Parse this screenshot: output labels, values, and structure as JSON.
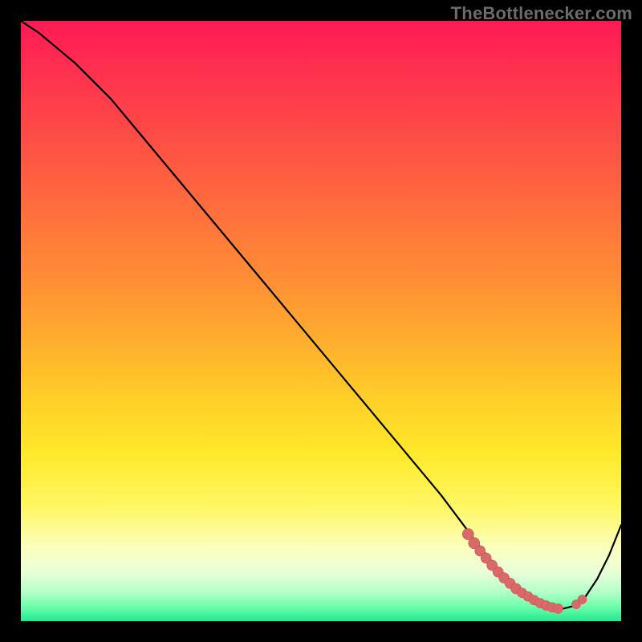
{
  "attribution": "TheBottlenecker.com",
  "colors": {
    "page_bg": "#000000",
    "curve": "#000000",
    "dot_fill": "#d86a6a",
    "dot_stroke": "#c85151",
    "attribution_text": "#6b6b6b"
  },
  "chart_data": {
    "type": "line",
    "title": "",
    "xlabel": "",
    "ylabel": "",
    "xlim": [
      0,
      100
    ],
    "ylim": [
      0,
      100
    ],
    "series": [
      {
        "name": "bottleneck_curve",
        "x": [
          0,
          3,
          6,
          9,
          12,
          15,
          20,
          25,
          30,
          35,
          40,
          45,
          50,
          55,
          60,
          65,
          70,
          73,
          76,
          78,
          80,
          82,
          84,
          86,
          88,
          90,
          92,
          94,
          96,
          98,
          100
        ],
        "y": [
          100,
          98,
          95.5,
          93,
          90,
          87,
          81,
          75,
          69,
          63,
          57,
          51,
          45,
          39,
          33,
          27,
          21,
          17,
          13,
          10.5,
          8,
          6,
          4.2,
          3,
          2.2,
          2,
          2.5,
          4,
          7,
          11,
          16
        ]
      }
    ],
    "highlight_points": {
      "name": "sweet_spot_markers",
      "x": [
        74.5,
        75.5,
        76.5,
        77.5,
        78.5,
        79.5,
        80.5,
        81.5,
        82.5,
        83.5,
        84.5,
        85.5,
        86.5,
        87.5,
        88.5,
        89.5,
        92.5,
        93.5
      ],
      "y": [
        14.5,
        13,
        11.7,
        10.5,
        9.3,
        8.2,
        7.2,
        6.3,
        5.4,
        4.7,
        4.1,
        3.5,
        3,
        2.6,
        2.3,
        2.1,
        2.8,
        3.6
      ],
      "r": [
        7,
        7,
        6.5,
        6.5,
        6.5,
        6.5,
        6.5,
        6.5,
        6.5,
        6,
        6,
        6,
        6,
        6,
        6,
        6,
        5.5,
        5.5
      ]
    }
  }
}
